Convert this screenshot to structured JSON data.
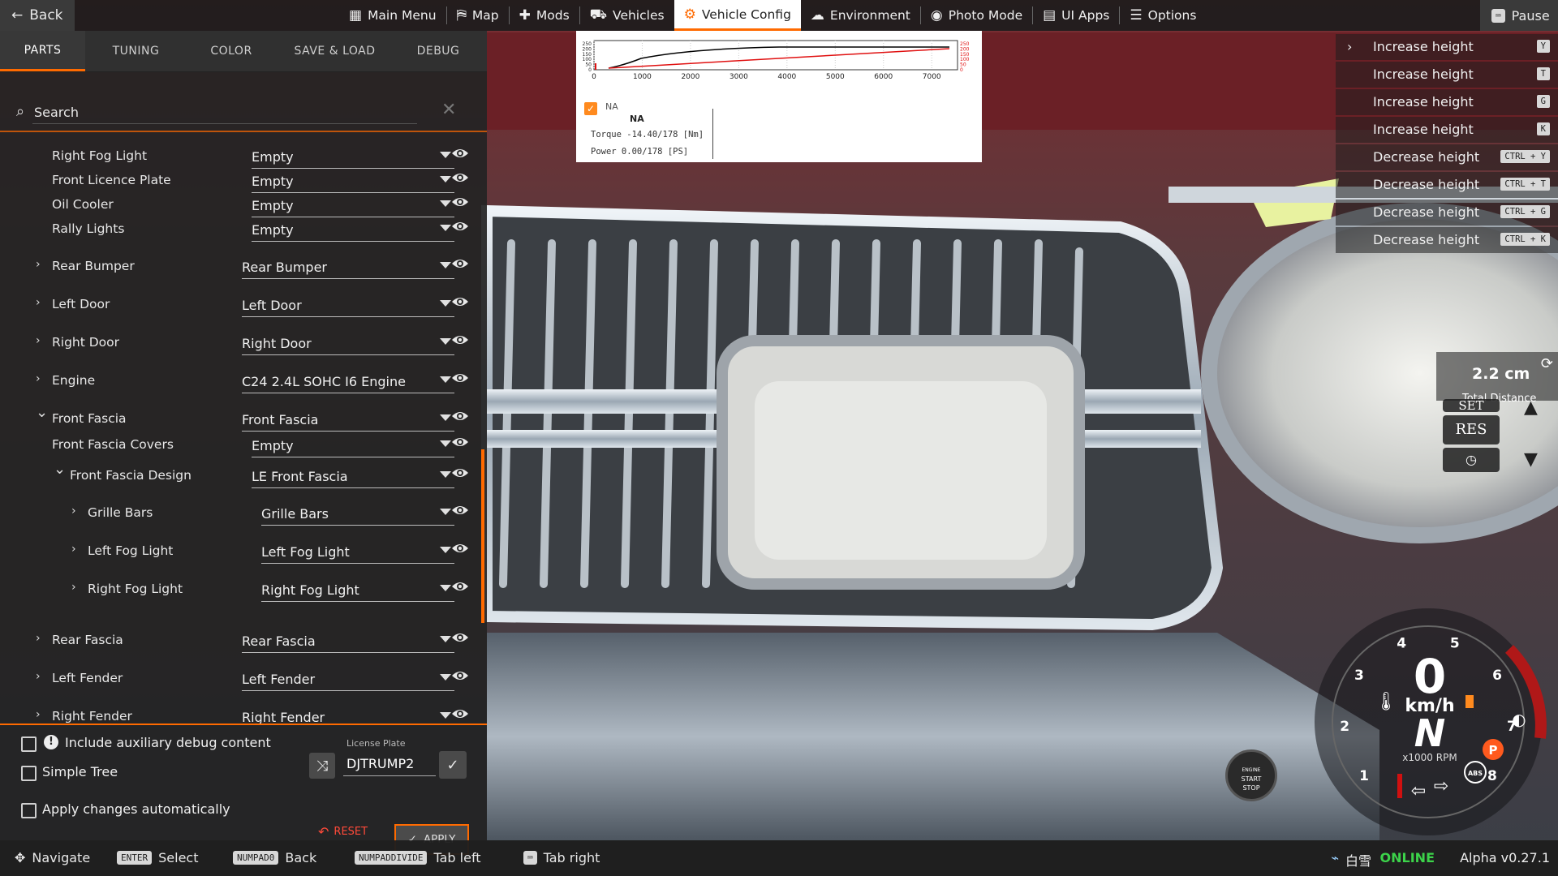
{
  "topbar": {
    "back_label": "Back",
    "nav": [
      {
        "label": "Main Menu",
        "icon": "main-menu-icon",
        "glyph": "▦"
      },
      {
        "label": "Map",
        "icon": "map-icon",
        "glyph": "⛿"
      },
      {
        "label": "Mods",
        "icon": "puzzle-icon",
        "glyph": "✚"
      },
      {
        "label": "Vehicles",
        "icon": "car-icon",
        "glyph": "⛟"
      },
      {
        "label": "Vehicle Config",
        "icon": "engine-icon",
        "glyph": "⚙",
        "active": true
      },
      {
        "label": "Environment",
        "icon": "weather-icon",
        "glyph": "☁"
      },
      {
        "label": "Photo Mode",
        "icon": "camera-icon",
        "glyph": "◉"
      },
      {
        "label": "UI Apps",
        "icon": "apps-icon",
        "glyph": "▤"
      },
      {
        "label": "Options",
        "icon": "sliders-icon",
        "glyph": "☰"
      }
    ],
    "pause_label": "Pause"
  },
  "tabs": [
    "PARTS",
    "TUNING",
    "COLOR",
    "SAVE & LOAD",
    "DEBUG"
  ],
  "search": {
    "placeholder": "Search"
  },
  "tree": [
    {
      "label": "Right Fog Light",
      "value": "Empty",
      "expandable": false,
      "indent": 0
    },
    {
      "label": "Front Licence Plate",
      "value": "Empty",
      "expandable": false,
      "indent": 0
    },
    {
      "label": "Oil Cooler",
      "value": "Empty",
      "expandable": false,
      "indent": 0
    },
    {
      "label": "Rally Lights",
      "value": "Empty",
      "expandable": false,
      "indent": 0
    },
    {
      "label": "Rear Bumper",
      "value": "Rear Bumper",
      "expandable": true,
      "expanded": false,
      "indent": 0
    },
    {
      "label": "Left Door",
      "value": "Left Door",
      "expandable": true,
      "expanded": false,
      "indent": 0
    },
    {
      "label": "Right Door",
      "value": "Right Door",
      "expandable": true,
      "expanded": false,
      "indent": 0
    },
    {
      "label": "Engine",
      "value": "C24 2.4L SOHC I6 Engine",
      "expandable": true,
      "expanded": false,
      "indent": 0
    },
    {
      "label": "Front Fascia",
      "value": "Front Fascia",
      "expandable": true,
      "expanded": true,
      "indent": 0
    },
    {
      "label": "Front Fascia Covers",
      "value": "Empty",
      "expandable": false,
      "indent": 0
    },
    {
      "label": "Front Fascia Design",
      "value": "LE Front Fascia",
      "expandable": true,
      "expanded": true,
      "indent": 1
    },
    {
      "label": "Grille Bars",
      "value": "Grille Bars",
      "expandable": true,
      "expanded": false,
      "indent": 2
    },
    {
      "label": "Left Fog Light",
      "value": "Left Fog Light",
      "expandable": true,
      "expanded": false,
      "indent": 2
    },
    {
      "label": "Right Fog Light",
      "value": "Right Fog Light",
      "expandable": true,
      "expanded": false,
      "indent": 2
    },
    {
      "label": "Rear Fascia",
      "value": "Rear Fascia",
      "expandable": true,
      "expanded": false,
      "indent": 0
    },
    {
      "label": "Left Fender",
      "value": "Left Fender",
      "expandable": true,
      "expanded": false,
      "indent": 0
    },
    {
      "label": "Right Fender",
      "value": "Right Fender",
      "expandable": true,
      "expanded": false,
      "indent": 0
    }
  ],
  "options": {
    "include_debug": {
      "label": "Include auxiliary debug content",
      "checked": false
    },
    "simple_tree": {
      "label": "Simple Tree",
      "checked": false
    },
    "apply_auto": {
      "label": "Apply changes automatically",
      "checked": false
    },
    "license_plate_caption": "License Plate",
    "license_plate_value": "DJTRUMP2",
    "reset_label": "RESET",
    "apply_label": "APPLY"
  },
  "bottombar": {
    "hints": [
      {
        "key": "",
        "label": "Navigate",
        "icon": "dpad-icon"
      },
      {
        "key": "ENTER",
        "label": "Select"
      },
      {
        "key": "NUMPAD0",
        "label": "Back"
      },
      {
        "key": "NUMPADDIVIDE",
        "label": "Tab left"
      },
      {
        "key": "",
        "label": "Tab right",
        "icon": "key-icon"
      }
    ],
    "region": "白雪",
    "status": "ONLINE",
    "version": "Alpha v0.27.1"
  },
  "graph": {
    "na_small": "NA",
    "na_big": "NA",
    "torque": "Torque -14.40/178 [Nm]",
    "power": "Power  0.00/178   [PS]",
    "x_ticks": [
      "0",
      "1000",
      "2000",
      "3000",
      "4000",
      "5000",
      "6000",
      "7000"
    ],
    "y_ticks_left": [
      "250",
      "200",
      "150",
      "100",
      "50",
      "0"
    ],
    "y_ticks_right": [
      "250",
      "200",
      "150",
      "100",
      "50",
      "0"
    ],
    "torque_curve_color": "#000000",
    "power_curve_color": "#e01010"
  },
  "keymap": [
    {
      "label": "Increase height",
      "key": "Y"
    },
    {
      "label": "Increase height",
      "key": "T"
    },
    {
      "label": "Increase height",
      "key": "G"
    },
    {
      "label": "Increase height",
      "key": "K"
    },
    {
      "label": "Decrease height",
      "key": "CTRL + Y"
    },
    {
      "label": "Decrease height",
      "key": "CTRL + T"
    },
    {
      "label": "Decrease height",
      "key": "CTRL + G"
    },
    {
      "label": "Decrease height",
      "key": "CTRL + K"
    }
  ],
  "distance": {
    "value": "2.2 cm",
    "caption": "Total Distance"
  },
  "cruise": {
    "set": "SET",
    "res": "RES"
  },
  "gauge": {
    "speed": "0",
    "speed_unit": "km/h",
    "gear": "N",
    "rpm_unit": "x1000 RPM",
    "rpm_ticks": [
      "1",
      "2",
      "3",
      "4",
      "5",
      "6",
      "7",
      "8"
    ],
    "park": "P",
    "abs": "ABS",
    "start_stop": [
      "ENGINE",
      "START",
      "STOP"
    ]
  },
  "colors": {
    "accent": "#ff6a00",
    "online": "#3cd34a",
    "reset": "#ff4a3a"
  }
}
